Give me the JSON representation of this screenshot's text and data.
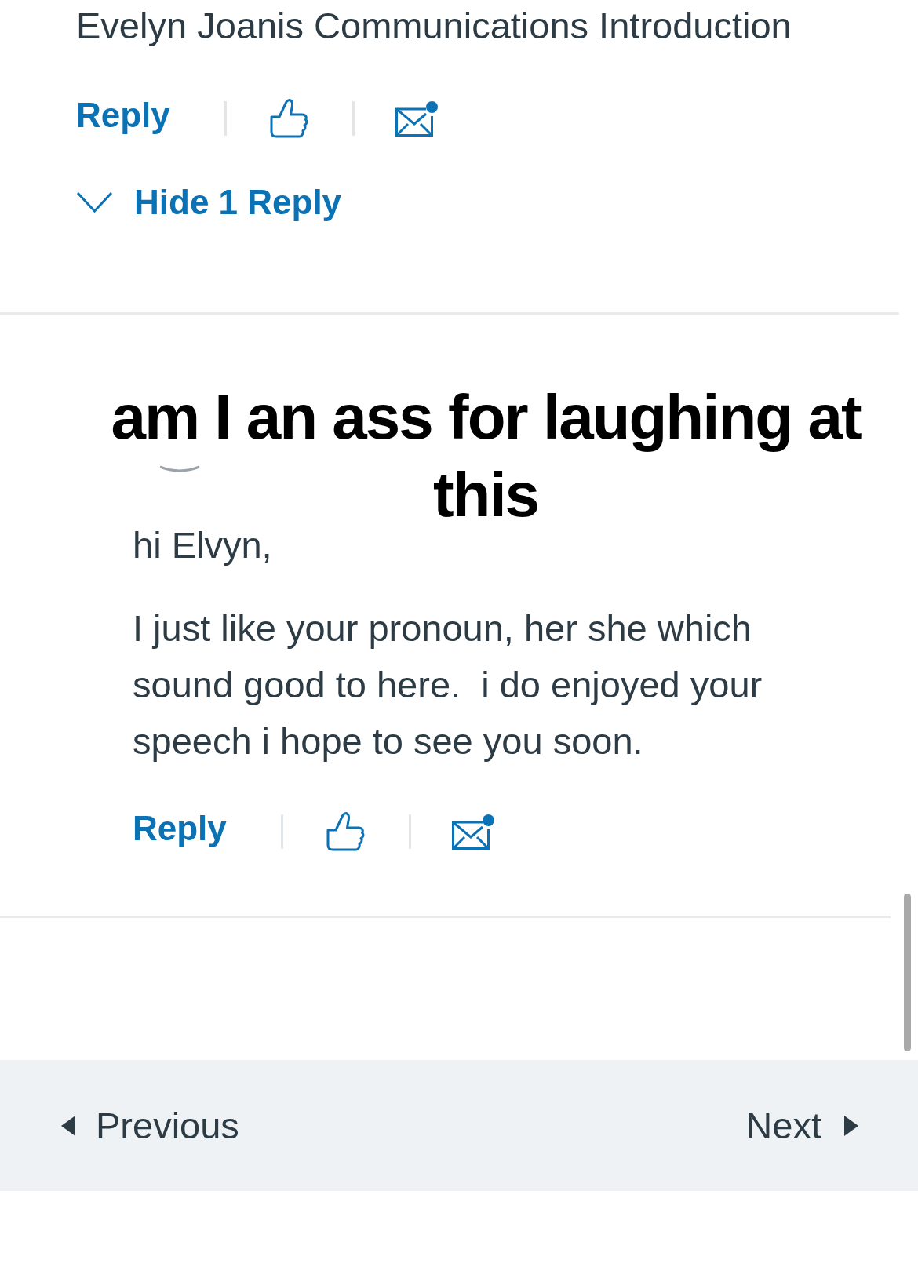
{
  "entry": {
    "title": "Evelyn Joanis Communications Introduction",
    "actions": {
      "reply": "Reply",
      "liked": false,
      "unread": true
    },
    "replies_toggle": {
      "label": "Hide 1 Reply",
      "expanded": true
    }
  },
  "reply": {
    "greeting": "hi Elvyn,",
    "body": "I just like your pronoun, her she which sound good to here.  i do enjoyed your speech i hope to see you soon.",
    "actions": {
      "reply": "Reply",
      "liked": false,
      "unread": true
    }
  },
  "overlay_caption": {
    "lines": [
      "am I an ass for laughing at",
      "this"
    ]
  },
  "pagination": {
    "previous": "Previous",
    "next": "Next"
  }
}
